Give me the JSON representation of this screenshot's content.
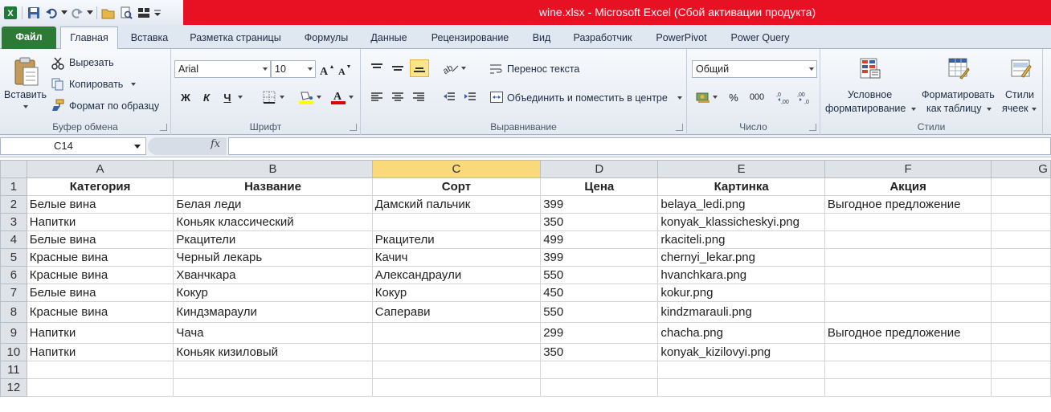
{
  "window": {
    "title": "wine.xlsx  -  Microsoft Excel (Сбой активации продукта)",
    "titlebar_color": "#e81123"
  },
  "quick_access": {
    "icons": [
      "excel-icon",
      "save-icon",
      "undo-icon",
      "redo-icon",
      "open-icon",
      "print-preview-icon",
      "layout-icon"
    ]
  },
  "tabs": [
    {
      "label": "Файл"
    },
    {
      "label": "Главная"
    },
    {
      "label": "Вставка"
    },
    {
      "label": "Разметка страницы"
    },
    {
      "label": "Формулы"
    },
    {
      "label": "Данные"
    },
    {
      "label": "Рецензирование"
    },
    {
      "label": "Вид"
    },
    {
      "label": "Разработчик"
    },
    {
      "label": "PowerPivot"
    },
    {
      "label": "Power Query"
    }
  ],
  "ribbon": {
    "clipboard": {
      "paste": "Вставить",
      "cut": "Вырезать",
      "copy": "Копировать",
      "format_painter": "Формат по образцу",
      "label": "Буфер обмена"
    },
    "font": {
      "name": "Arial",
      "size": "10",
      "bold": "Ж",
      "italic": "К",
      "underline": "Ч",
      "label": "Шрифт"
    },
    "alignment": {
      "wrap_text": "Перенос текста",
      "merge_center": "Объединить и поместить в центре",
      "label": "Выравнивание"
    },
    "number": {
      "format": "Общий",
      "percent": "%",
      "thousands": "000",
      "label": "Число"
    },
    "styles": {
      "conditional": [
        "Условное",
        "форматирование"
      ],
      "format_table": [
        "Форматировать",
        "как таблицу"
      ],
      "cell_styles": [
        "Стили",
        "ячеек"
      ],
      "label": "Стили"
    }
  },
  "formula_bar": {
    "name_box": "C14",
    "fx": "fx",
    "value": ""
  },
  "sheet": {
    "columns": [
      "A",
      "B",
      "C",
      "D",
      "E",
      "F",
      "G"
    ],
    "selected_column": "C",
    "rows": [
      {
        "n": "1",
        "cells": [
          "Категория",
          "Название",
          "Сорт",
          "Цена",
          "Картинка",
          "Акция"
        ]
      },
      {
        "n": "2",
        "cells": [
          "Белые вина",
          "Белая леди",
          "Дамский пальчик",
          "399",
          "belaya_ledi.png",
          "Выгодное предложение"
        ]
      },
      {
        "n": "3",
        "cells": [
          "Напитки",
          "Коньяк классический",
          "",
          "350",
          "konyak_klassicheskyi.png",
          ""
        ]
      },
      {
        "n": "4",
        "cells": [
          "Белые вина",
          "Ркацители",
          "Ркацители",
          "499",
          "rkaciteli.png",
          ""
        ]
      },
      {
        "n": "5",
        "cells": [
          "Красные вина",
          "Черный лекарь",
          "Качич",
          "399",
          "chernyi_lekar.png",
          ""
        ]
      },
      {
        "n": "6",
        "cells": [
          "Красные вина",
          "Хванчкара",
          "Александраули",
          "550",
          "hvanchkara.png",
          ""
        ]
      },
      {
        "n": "7",
        "cells": [
          "Белые вина",
          "Кокур",
          "Кокур",
          "450",
          "kokur.png",
          ""
        ]
      },
      {
        "n": "8",
        "cells": [
          "Красные вина",
          "Киндзмараули",
          "Саперави",
          "550",
          "kindzmarauli.png",
          ""
        ]
      },
      {
        "n": "9",
        "cells": [
          "Напитки",
          "Чача",
          "",
          "299",
          "chacha.png",
          "Выгодное предложение"
        ]
      },
      {
        "n": "10",
        "cells": [
          "Напитки",
          "Коньяк кизиловый",
          "",
          "350",
          "konyak_kizilovyi.png",
          ""
        ]
      },
      {
        "n": "11",
        "cells": [
          "",
          "",
          "",
          "",
          "",
          ""
        ]
      },
      {
        "n": "12",
        "cells": [
          "",
          "",
          "",
          "",
          "",
          ""
        ]
      }
    ]
  }
}
